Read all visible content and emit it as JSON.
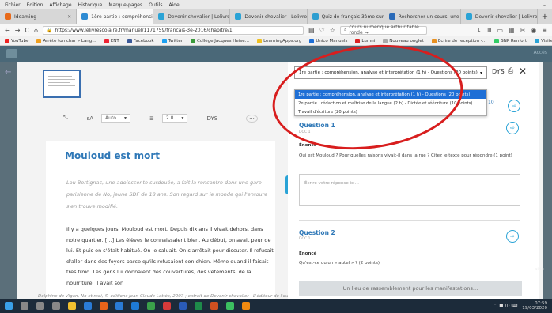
{
  "menubar": {
    "items": [
      "Fichier",
      "Édition",
      "Affichage",
      "Historique",
      "Marque-pages",
      "Outils",
      "Aide"
    ],
    "right": "–"
  },
  "tabs": [
    {
      "label": "Ideaming",
      "color": "#e86a1a"
    },
    {
      "label": "1ère partie : compréhension, a…",
      "color": "#2e8bd3",
      "active": true
    },
    {
      "label": "Devenir chevalier | Lelivresc…",
      "color": "#2aa3d6"
    },
    {
      "label": "Devenir chevalier | Lelivresc…",
      "color": "#2aa3d6"
    },
    {
      "label": "Quiz de français 3ème sur le…",
      "color": "#2e9ed0"
    },
    {
      "label": "Rechercher un cours, une vi…",
      "color": "#2a6ab8"
    },
    {
      "label": "Devenir chevalier | Lelivresc…",
      "color": "#2aa3d6"
    }
  ],
  "nav": {
    "url": "https://www.lelivrescolaire.fr/manuel/1171759/francais-3e-2016/chapitre/1",
    "search_placeholder": "cours numérique arthur table ronde →",
    "back": "←",
    "forward": "→",
    "reload": "C",
    "home": "⌂"
  },
  "bookmarks": [
    {
      "label": "YouTube",
      "color": "#e22"
    },
    {
      "label": "Arrête ton char » Lang…",
      "color": "#f0a020"
    },
    {
      "label": "ENT",
      "color": "#e23"
    },
    {
      "label": "Facebook",
      "color": "#3b5998"
    },
    {
      "label": "Twitter",
      "color": "#1da1f2"
    },
    {
      "label": "Collège Jacques Heise…",
      "color": "#3a9a3a"
    },
    {
      "label": "LearningApps.org",
      "color": "#f0c020"
    },
    {
      "label": "Unico Manuels",
      "color": "#1e6fd6"
    },
    {
      "label": "Lumni",
      "color": "#d22"
    },
    {
      "label": "Nouveau onglet",
      "color": "#aaa"
    },
    {
      "label": "Ecrire de reception -…",
      "color": "#e89020"
    },
    {
      "label": "SNP Renfort",
      "color": "#3c6"
    },
    {
      "label": "Visite interactive du site…",
      "color": "#2aa3d6"
    }
  ],
  "site": {
    "right_text": "Accès"
  },
  "left_toolbar": {
    "font_size_label": "sA",
    "font_select": "Auto",
    "spacing_select": "2.0",
    "dys_label": "DYS",
    "more": "···",
    "expand": "⤡"
  },
  "document": {
    "title": "Mouloud est mort",
    "intro": "Lou Bertignac, une adolescente surdouée, a fait la rencontre dans une gare parisienne de No, jeune SDF de 18 ans. Son regard sur le monde qui l'entoure s'en trouve modifié.",
    "body": "Il y a quelques jours, Mouloud est mort. Depuis dix ans il vivait dehors, dans notre quartier. […] Les élèves le connaissaient bien. Au début, on avait peur de lui. Et puis on s'était habitué. On le saluait. On s'arrêtait pour discuter. Il refusait d'aller dans des foyers parce qu'ils refusaient son chien. Même quand il faisait très froid. Les gens lui donnaient des couvertures, des vêtements, de la nourriture. Il avait son",
    "caption": "Delphine de Vigan, No et moi, © éditions Jean-Claude Lattès, 2007 ; extrait de Devenir chevalier | L'éditeur de l'ouvrage"
  },
  "panel": {
    "selected_section": "1re partie : compréhension, analyse et interprétation (1 h) - Questions (20 points)",
    "dys": "DYS",
    "dropdown_options": [
      "1re partie : compréhension, analyse et interprétation (1 h) - Questions (20 points)",
      "2e partie : rédaction et maîtrise de la langue (2 h) - Dictée et réécriture (10 points)",
      "Travail d'écriture (20 points)"
    ],
    "side_number": "10",
    "q1": {
      "title": "Question 1",
      "sub": "DOC 1",
      "label": "Énoncé",
      "text": "Qui est Mouloud ? Pour quelles raisons vivait-il dans la rue ? Citez le texte pour répondre (1 point)",
      "placeholder": "Écrire votre réponse ici…"
    },
    "q2": {
      "title": "Question 2",
      "sub": "DOC 1",
      "label": "Énoncé",
      "text": "Qu'est-ce qu'un « autel » ? (2 points)"
    },
    "bottom_bar": "Un lieu de rassemblement pour les manifestations…",
    "side_right_text": "aide…"
  },
  "taskbar": {
    "icons": [
      {
        "name": "windows-icon",
        "color": "#3aa0e8"
      },
      {
        "name": "search-icon",
        "color": "#888"
      },
      {
        "name": "cortana-icon",
        "color": "#888"
      },
      {
        "name": "task-view-icon",
        "color": "#888"
      },
      {
        "name": "file-explorer-icon",
        "color": "#f0c030"
      },
      {
        "name": "store-icon",
        "color": "#2a7bd6"
      },
      {
        "name": "firefox-icon",
        "color": "#e8631a"
      },
      {
        "name": "mail-icon",
        "color": "#2a7bd6"
      },
      {
        "name": "edge-icon",
        "color": "#1e7ad6"
      },
      {
        "name": "chrome-icon",
        "color": "#3aa04a"
      },
      {
        "name": "media-icon",
        "color": "#d63a3a"
      },
      {
        "name": "word-icon",
        "color": "#2a5bb8"
      },
      {
        "name": "excel-icon",
        "color": "#1e8a4a"
      },
      {
        "name": "powerpoint-icon",
        "color": "#d05020"
      },
      {
        "name": "green-app-icon",
        "color": "#3cc060"
      },
      {
        "name": "vlc-icon",
        "color": "#f08a10"
      }
    ],
    "tray": "^ ■ ))) ⌨",
    "time": "07:59",
    "date": "19/03/2020"
  },
  "colors": {
    "accent": "#2f78b7",
    "highlight": "#1e6fd6",
    "annotation": "#d81e1e"
  }
}
